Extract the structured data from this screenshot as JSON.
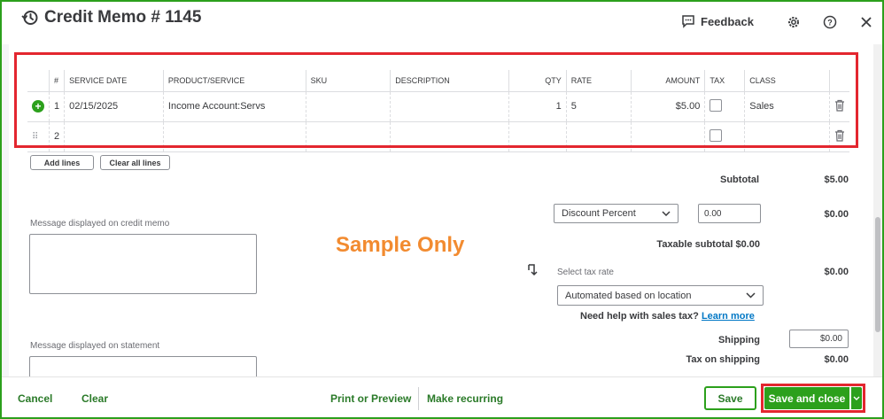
{
  "header": {
    "title": "Credit Memo # 1145",
    "feedback_label": "Feedback",
    "icons": [
      "history-icon",
      "chat-icon",
      "gear-icon",
      "help-icon",
      "close-icon"
    ]
  },
  "table": {
    "columns": [
      "#",
      "SERVICE DATE",
      "PRODUCT/SERVICE",
      "SKU",
      "DESCRIPTION",
      "QTY",
      "RATE",
      "AMOUNT",
      "TAX",
      "CLASS"
    ],
    "rows": [
      {
        "num": "1",
        "service_date": "02/15/2025",
        "product": "Income Account:Servs",
        "sku": "",
        "description": "",
        "qty": "1",
        "rate": "5",
        "amount": "$5.00",
        "tax": false,
        "class": "Sales"
      },
      {
        "num": "2",
        "service_date": "",
        "product": "",
        "sku": "",
        "description": "",
        "qty": "",
        "rate": "",
        "amount": "",
        "tax": false,
        "class": ""
      }
    ]
  },
  "buttons": {
    "add_lines": "Add lines",
    "clear_all_lines": "Clear all lines"
  },
  "messages": {
    "credit_memo_label": "Message displayed on credit memo",
    "credit_memo_value": "",
    "statement_label": "Message displayed on statement",
    "statement_value": ""
  },
  "watermark": "Sample Only",
  "totals": {
    "subtotal_label": "Subtotal",
    "subtotal_value": "$5.00",
    "discount_type": "Discount Percent",
    "discount_input": "0.00",
    "discount_value": "$0.00",
    "taxable_subtotal": "Taxable subtotal $0.00",
    "tax_rate_label": "Select tax rate",
    "tax_rate_option": "Automated based on location",
    "tax_value": "$0.00",
    "help_text": "Need help with sales tax?",
    "learn_more": "Learn more",
    "shipping_label": "Shipping",
    "shipping_input": "$0.00",
    "tax_on_shipping_label": "Tax on shipping",
    "tax_on_shipping_value": "$0.00"
  },
  "footer": {
    "cancel": "Cancel",
    "clear": "Clear",
    "print_preview": "Print or Preview",
    "make_recurring": "Make recurring",
    "save": "Save",
    "save_and_close": "Save and close"
  },
  "colors": {
    "brand_green": "#2ca01c",
    "highlight_red": "#e3262f",
    "watermark_orange": "#f28b30",
    "link_blue": "#0077c5"
  }
}
